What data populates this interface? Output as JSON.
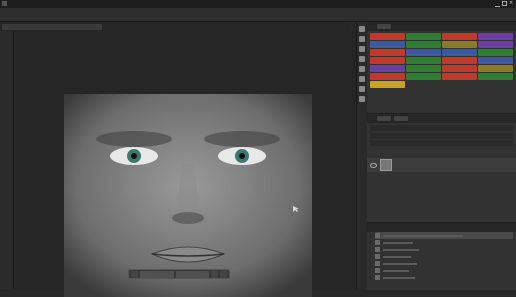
{
  "window": {
    "title": ""
  },
  "colors": {
    "accent": "#3a6ea5",
    "action_colors": [
      "#c0392b",
      "#2e7d32",
      "#c0392b",
      "#6a3fa0",
      "#3d5a9e",
      "#2e7d32",
      "#8a7a2a",
      "#6a3fa0",
      "#c0392b",
      "#3d5a9e",
      "#3d5a9e",
      "#2e7d32",
      "#c0392b",
      "#2e7d32",
      "#c0392b",
      "#3d5a9e",
      "#6a3fa0",
      "#2e7d32",
      "#c0392b",
      "#8a7a2a",
      "#c0392b",
      "#2e7d32",
      "#c0392b",
      "#2e7d32",
      "#c9a227",
      "",
      "",
      ""
    ]
  },
  "panels": {
    "actions_tab": "",
    "layers_tab": "",
    "history_tab": "",
    "layer_name": ""
  },
  "context_bar": {
    "button1": "",
    "button2": ""
  }
}
